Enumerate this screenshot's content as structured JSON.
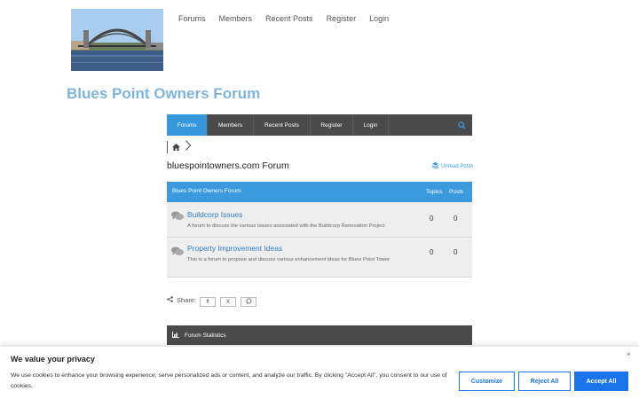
{
  "header": {
    "logo_alt": "bridge-photo",
    "nav": [
      "Forums",
      "Members",
      "Recent Posts",
      "Register",
      "Login"
    ],
    "site_title": "Blues Point Owners Forum"
  },
  "forum_nav": {
    "items": [
      "Forums",
      "Members",
      "Recent Posts",
      "Register",
      "Login"
    ],
    "active": "Forums",
    "accent": "#3797dc"
  },
  "main": {
    "heading": "bluespointowners.com Forum",
    "unread_label": "Unread Posts",
    "table": {
      "category": "Blues Point Owners Forum",
      "col_topics": "Topics",
      "col_posts": "Posts",
      "rows": [
        {
          "title": "Buildcorp Issues",
          "desc": "A forum to discuss the various issues associated with the Buildcorp Renovation Project",
          "topics": "0",
          "posts": "0"
        },
        {
          "title": "Property Improvement Ideas",
          "desc": "This is a forum to propose and discuss various enhancement ideas for Blues Point Tower",
          "topics": "0",
          "posts": "0"
        }
      ]
    },
    "share_label": "Share:",
    "share_buttons": [
      "f",
      "X",
      "W"
    ],
    "stats_label": "Forum Statistics"
  },
  "cookie": {
    "title": "We value your privacy",
    "text": "We use cookies to enhance your browsing experience, serve personalized ads or content, and analyze our traffic. By clicking \"Accept All\", you consent to our use of cookies.",
    "customize": "Customize",
    "reject": "Reject All",
    "accept": "Accept All",
    "close": "×"
  }
}
